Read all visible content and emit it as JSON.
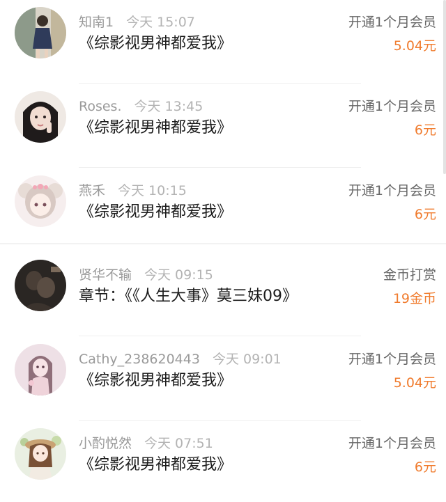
{
  "records": [
    {
      "name": "知南1",
      "time": "今天 15:07",
      "title": "《综影视男神都爱我》",
      "action": "开通1个月会员",
      "amount": "5.04元"
    },
    {
      "name": "Roses.",
      "time": "今天 13:45",
      "title": "《综影视男神都爱我》",
      "action": "开通1个月会员",
      "amount": "6元"
    },
    {
      "name": "燕禾",
      "time": "今天 10:15",
      "title": "《综影视男神都爱我》",
      "action": "开通1个月会员",
      "amount": "6元"
    },
    {
      "name": "贤华不输",
      "time": "今天 09:15",
      "title": "章节：《《人生大事》莫三妹09》",
      "action": "金币打赏",
      "amount": "19金币"
    },
    {
      "name": "Cathy_238620443",
      "time": "今天 09:01",
      "title": "《综影视男神都爱我》",
      "action": "开通1个月会员",
      "amount": "5.04元"
    },
    {
      "name": "小酌悦然",
      "time": "今天 07:51",
      "title": "《综影视男神都爱我》",
      "action": "开通1个月会员",
      "amount": "6元"
    }
  ],
  "colors": {
    "amount": "#f07b2d",
    "title": "#1c1c1c",
    "meta": "#9a9a9a"
  }
}
